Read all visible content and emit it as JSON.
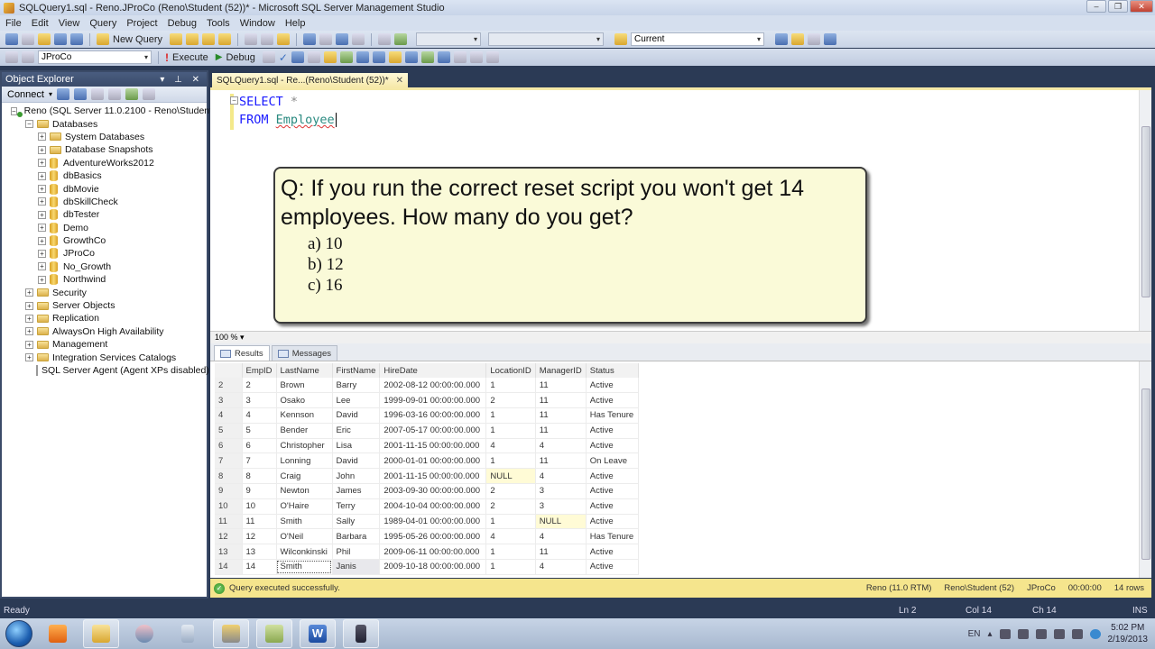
{
  "window": {
    "title": "SQLQuery1.sql - Reno.JProCo (Reno\\Student (52))* - Microsoft SQL Server Management Studio",
    "controls": [
      "minimize",
      "restore",
      "close"
    ]
  },
  "menu": [
    "File",
    "Edit",
    "View",
    "Query",
    "Project",
    "Debug",
    "Tools",
    "Window",
    "Help"
  ],
  "toolbar1": {
    "new_query_label": "New Query",
    "solution_config": "Current"
  },
  "toolbar2": {
    "database": "JProCo",
    "execute_label": "Execute",
    "debug_label": "Debug"
  },
  "object_explorer": {
    "title": "Object Explorer",
    "connect_label": "Connect",
    "server": "Reno (SQL Server 11.0.2100 - Reno\\Student)",
    "databases_label": "Databases",
    "database_folders": [
      "System Databases",
      "Database Snapshots"
    ],
    "databases": [
      "AdventureWorks2012",
      "dbBasics",
      "dbMovie",
      "dbSkillCheck",
      "dbTester",
      "Demo",
      "GrowthCo",
      "JProCo",
      "No_Growth",
      "Northwind"
    ],
    "server_folders": [
      "Security",
      "Server Objects",
      "Replication",
      "AlwaysOn High Availability",
      "Management",
      "Integration Services Catalogs"
    ],
    "agent": "SQL Server Agent (Agent XPs disabled)"
  },
  "editor": {
    "tab_label": "SQLQuery1.sql - Re...(Reno\\Student (52))*",
    "line1_kw": "SELECT",
    "line1_rest": "*",
    "line2_kw": "FROM",
    "line2_table": "Employee",
    "zoom": "100 %"
  },
  "question": {
    "text": "Q: If you run the correct reset script you won't get 14 employees. How many do you get?",
    "options": [
      "a)  10",
      "b)  12",
      "c)  16"
    ]
  },
  "results": {
    "tabs": [
      "Results",
      "Messages"
    ],
    "columns": [
      "EmpID",
      "LastName",
      "FirstName",
      "HireDate",
      "LocationID",
      "ManagerID",
      "Status"
    ],
    "rows": [
      [
        "2",
        "2",
        "Brown",
        "Barry",
        "2002-08-12 00:00:00.000",
        "1",
        "11",
        "Active"
      ],
      [
        "3",
        "3",
        "Osako",
        "Lee",
        "1999-09-01 00:00:00.000",
        "2",
        "11",
        "Active"
      ],
      [
        "4",
        "4",
        "Kennson",
        "David",
        "1996-03-16 00:00:00.000",
        "1",
        "11",
        "Has Tenure"
      ],
      [
        "5",
        "5",
        "Bender",
        "Eric",
        "2007-05-17 00:00:00.000",
        "1",
        "11",
        "Active"
      ],
      [
        "6",
        "6",
        "Christopher",
        "Lisa",
        "2001-11-15 00:00:00.000",
        "4",
        "4",
        "Active"
      ],
      [
        "7",
        "7",
        "Lonning",
        "David",
        "2000-01-01 00:00:00.000",
        "1",
        "11",
        "On Leave"
      ],
      [
        "8",
        "8",
        "Craig",
        "John",
        "2001-11-15 00:00:00.000",
        "NULL",
        "4",
        "Active"
      ],
      [
        "9",
        "9",
        "Newton",
        "James",
        "2003-09-30 00:00:00.000",
        "2",
        "3",
        "Active"
      ],
      [
        "10",
        "10",
        "O'Haire",
        "Terry",
        "2004-10-04 00:00:00.000",
        "2",
        "3",
        "Active"
      ],
      [
        "11",
        "11",
        "Smith",
        "Sally",
        "1989-04-01 00:00:00.000",
        "1",
        "NULL",
        "Active"
      ],
      [
        "12",
        "12",
        "O'Neil",
        "Barbara",
        "1995-05-26 00:00:00.000",
        "4",
        "4",
        "Has Tenure"
      ],
      [
        "13",
        "13",
        "Wilconkinski",
        "Phil",
        "2009-06-11 00:00:00.000",
        "1",
        "11",
        "Active"
      ],
      [
        "14",
        "14",
        "Smith",
        "Janis",
        "2009-10-18 00:00:00.000",
        "1",
        "4",
        "Active"
      ]
    ]
  },
  "query_status": {
    "message": "Query executed successfully.",
    "server": "Reno (11.0 RTM)",
    "user": "Reno\\Student (52)",
    "database": "JProCo",
    "elapsed": "00:00:00",
    "rows": "14 rows"
  },
  "statusbar": {
    "state": "Ready",
    "ln": "Ln 2",
    "col": "Col 14",
    "ch": "Ch 14",
    "mode": "INS"
  },
  "taskbar": {
    "apps": [
      "media-player",
      "file-explorer",
      "snipping-tool",
      "calculator",
      "ssms",
      "notes",
      "word",
      "camera"
    ],
    "language": "EN",
    "time": "5:02 PM",
    "date": "2/19/2013"
  }
}
